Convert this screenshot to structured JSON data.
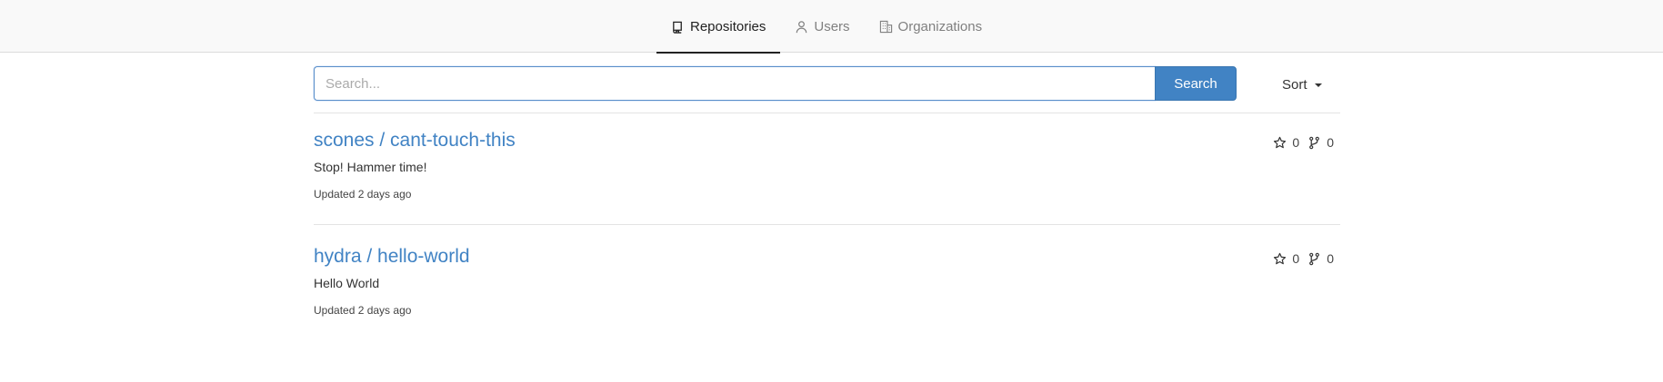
{
  "tabs": [
    {
      "label": "Repositories",
      "icon": "repo-icon",
      "active": true
    },
    {
      "label": "Users",
      "icon": "person-icon",
      "active": false
    },
    {
      "label": "Organizations",
      "icon": "organization-icon",
      "active": false
    }
  ],
  "search": {
    "placeholder": "Search...",
    "value": "",
    "button_label": "Search"
  },
  "sort": {
    "label": "Sort"
  },
  "repositories": [
    {
      "title": "scones / cant-touch-this",
      "description": "Stop! Hammer time!",
      "updated": "Updated 2 days ago",
      "stars": "0",
      "forks": "0"
    },
    {
      "title": "hydra / hello-world",
      "description": "Hello World",
      "updated": "Updated 2 days ago",
      "stars": "0",
      "forks": "0"
    }
  ],
  "colors": {
    "link": "#4183c4",
    "button": "#4183c4",
    "active_tab": "#222222"
  }
}
